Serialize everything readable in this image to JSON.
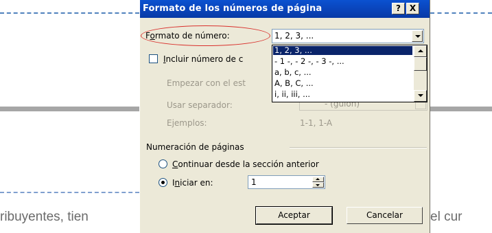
{
  "document": {
    "text_left": "ribuyentes, tien",
    "text_right": "el cur"
  },
  "dialog": {
    "title": "Formato de los números de página",
    "help_button": "?",
    "close_button": "X",
    "number_format": {
      "label_pre": "F",
      "label_u": "o",
      "label_post": "rmato de número:",
      "value": "1, 2, 3, ...",
      "options": [
        "1, 2, 3, ...",
        "- 1 -, - 2 -, - 3 -, ...",
        "a, b, c, ...",
        "A, B, C, ...",
        "i, ii, iii, ..."
      ],
      "selected_index": 0
    },
    "include_chapter": {
      "label_u": "I",
      "label_post": "ncluir número de c",
      "checked": false
    },
    "chapter_start_label": "Empezar con el est",
    "separator_label": "Usar separador:",
    "separator_value": "-  (guión)",
    "examples_label": "Ejemplos:",
    "examples_value": "1-1, 1-A",
    "page_numbering_group": "Numeración de páginas",
    "continue_option": {
      "label_u": "C",
      "label_post": "ontinuar desde la sección anterior",
      "checked": false
    },
    "start_at_option": {
      "label_pre": "I",
      "label_u": "n",
      "label_post": "iciar en:",
      "checked": true,
      "value": "1"
    },
    "ok_button": "Aceptar",
    "cancel_button": "Cancelar"
  }
}
